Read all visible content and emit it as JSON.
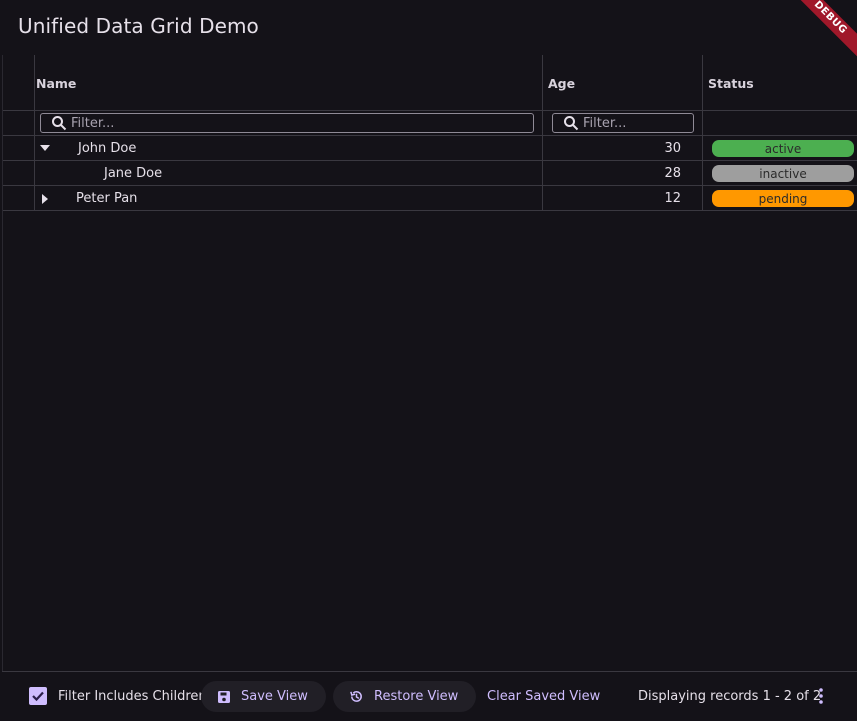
{
  "app": {
    "title": "Unified Data Grid Demo",
    "debug_label": "DEBUG"
  },
  "columns": [
    {
      "label": "Name",
      "filter_placeholder": "Filter..."
    },
    {
      "label": "Age",
      "filter_placeholder": "Filter..."
    },
    {
      "label": "Status"
    }
  ],
  "rows": [
    {
      "name": "John Doe",
      "age": "30",
      "status": "active",
      "status_color": "#4caf50",
      "expander": "expanded",
      "level": 0
    },
    {
      "name": "Jane Doe",
      "age": "28",
      "status": "inactive",
      "status_color": "#9e9e9e",
      "expander": "none",
      "level": 1
    },
    {
      "name": "Peter Pan",
      "age": "12",
      "status": "pending",
      "status_color": "#ff9800",
      "expander": "collapsed",
      "level": 0
    }
  ],
  "footer": {
    "filter_children_label": "Filter Includes Children",
    "filter_children_checked": true,
    "save_view_label": "Save View",
    "restore_view_label": "Restore View",
    "clear_saved_view_label": "Clear Saved View",
    "records_text": "Displaying records 1 - 2 of 2"
  },
  "colors": {
    "accent": "#cfbdfe",
    "background": "#141218",
    "debug": "#a0182a"
  }
}
